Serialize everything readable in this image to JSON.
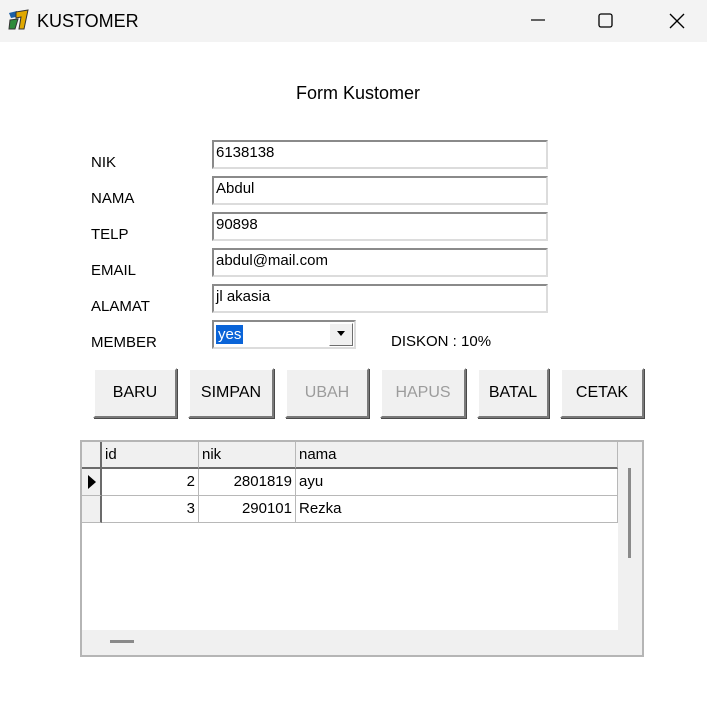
{
  "window": {
    "title": "KUSTOMER",
    "icon": "delphi-helmet-icon"
  },
  "form": {
    "title": "Form Kustomer",
    "labels": {
      "nik": "NIK",
      "nama": "NAMA",
      "telp": "TELP",
      "email": "EMAIL",
      "alamat": "ALAMAT",
      "member": "MEMBER"
    },
    "values": {
      "nik": "6138138",
      "nama": "Abdul",
      "telp": "90898",
      "email": "abdul@mail.com",
      "alamat": "jl akasia",
      "member": "yes"
    },
    "diskon": "DISKON : 10%"
  },
  "buttons": {
    "baru": "BARU",
    "simpan": "SIMPAN",
    "ubah": "UBAH",
    "hapus": "HAPUS",
    "batal": "BATAL",
    "cetak": "CETAK"
  },
  "grid": {
    "columns": [
      "id",
      "nik",
      "nama"
    ],
    "rows": [
      {
        "id": "2",
        "nik": "2801819",
        "nama": "ayu"
      },
      {
        "id": "3",
        "nik": "290101",
        "nama": "Rezka"
      }
    ]
  }
}
